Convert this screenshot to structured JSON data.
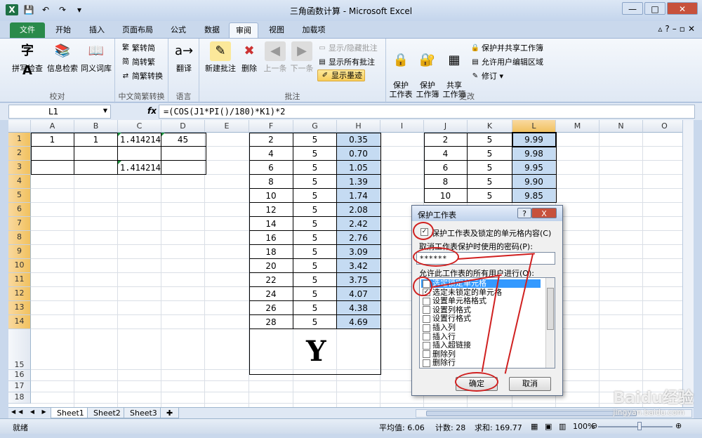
{
  "window": {
    "title": "三角函数计算 - Microsoft Excel",
    "qat_undo": "↶",
    "qat_redo": "↷"
  },
  "tabs": [
    "文件",
    "开始",
    "插入",
    "页面布局",
    "公式",
    "数据",
    "审阅",
    "视图",
    "加载项"
  ],
  "active_tab": "审阅",
  "ribbon": {
    "proofing": {
      "label": "校对",
      "spell": "拼写检查",
      "research": "信息检索",
      "thesaurus": "同义词库"
    },
    "chinese": {
      "label": "中文简繁转换",
      "t2s": "繁转简",
      "s2t": "简转繁",
      "convert": "简繁转换"
    },
    "language": {
      "label": "语言",
      "translate": "翻译"
    },
    "comments": {
      "label": "批注",
      "new": "新建批注",
      "delete": "删除",
      "prev": "上一条",
      "next": "下一条",
      "show_hide": "显示/隐藏批注",
      "show_all": "显示所有批注",
      "show_ink": "显示墨迹"
    },
    "changes": {
      "label": "更改",
      "protect_sheet": "保护\n工作表",
      "protect_wb": "保护\n工作簿",
      "share_wb": "共享\n工作簿",
      "protect_share": "保护并共享工作簿",
      "allow_edit": "允许用户编辑区域",
      "track": "修订"
    }
  },
  "formula_bar": {
    "name_box": "L1",
    "fx": "fx",
    "formula": "=(COS(J1*PI()/180)*K1)*2"
  },
  "columns": [
    "A",
    "B",
    "C",
    "D",
    "E",
    "F",
    "G",
    "H",
    "I",
    "J",
    "K",
    "L",
    "M",
    "N",
    "O"
  ],
  "selected_column": "L",
  "rows_top": [
    1,
    2,
    3,
    4,
    5,
    6,
    7,
    8,
    9,
    10,
    11,
    12,
    13,
    14
  ],
  "rows_bottom": [
    15,
    16,
    17,
    18
  ],
  "cells_abcd": {
    "a1": "1",
    "b1": "1",
    "c1": "1.414214",
    "d1": "45",
    "c3": "1.414214"
  },
  "table_fgh": [
    [
      "2",
      "5",
      "0.35"
    ],
    [
      "4",
      "5",
      "0.70"
    ],
    [
      "6",
      "5",
      "1.05"
    ],
    [
      "8",
      "5",
      "1.39"
    ],
    [
      "10",
      "5",
      "1.74"
    ],
    [
      "12",
      "5",
      "2.08"
    ],
    [
      "14",
      "5",
      "2.42"
    ],
    [
      "16",
      "5",
      "2.76"
    ],
    [
      "18",
      "5",
      "3.09"
    ],
    [
      "20",
      "5",
      "3.42"
    ],
    [
      "22",
      "5",
      "3.75"
    ],
    [
      "24",
      "5",
      "4.07"
    ],
    [
      "26",
      "5",
      "4.38"
    ],
    [
      "28",
      "5",
      "4.69"
    ]
  ],
  "big_label": "Y",
  "table_jkl": [
    [
      "2",
      "5",
      "9.99"
    ],
    [
      "4",
      "5",
      "9.98"
    ],
    [
      "6",
      "5",
      "9.95"
    ],
    [
      "8",
      "5",
      "9.90"
    ],
    [
      "10",
      "5",
      "9.85"
    ]
  ],
  "sheets": [
    "Sheet1",
    "Sheet2",
    "Sheet3"
  ],
  "active_sheet": "Sheet1",
  "status": {
    "mode": "就绪",
    "average": "平均值: 6.06",
    "count": "计数: 28",
    "sum": "求和: 169.77",
    "zoom": "100%"
  },
  "dialog": {
    "title": "保护工作表",
    "help": "?",
    "close": "X",
    "protect_label": "保护工作表及锁定的单元格内容(C)",
    "password_label": "取消工作表保护时使用的密码(P):",
    "password_value": "******",
    "allow_label": "允许此工作表的所有用户进行(O):",
    "options": [
      {
        "label": "选定锁定单元格",
        "checked": true,
        "selected": true
      },
      {
        "label": "选定未锁定的单元格",
        "checked": true,
        "selected": false
      },
      {
        "label": "设置单元格格式",
        "checked": false,
        "selected": false
      },
      {
        "label": "设置列格式",
        "checked": false,
        "selected": false
      },
      {
        "label": "设置行格式",
        "checked": false,
        "selected": false
      },
      {
        "label": "插入列",
        "checked": false,
        "selected": false
      },
      {
        "label": "插入行",
        "checked": false,
        "selected": false
      },
      {
        "label": "插入超链接",
        "checked": false,
        "selected": false
      },
      {
        "label": "删除列",
        "checked": false,
        "selected": false
      },
      {
        "label": "删除行",
        "checked": false,
        "selected": false
      }
    ],
    "ok": "确定",
    "cancel": "取消"
  },
  "watermark": {
    "brand": "Baidu经验",
    "url": "jingyan.baidu.com"
  },
  "colors": {
    "accent_red": "#d02020",
    "selected_header": "#f1c15f",
    "cell_blue": "#c5dbf2",
    "file_tab": "#2a8a4a"
  }
}
